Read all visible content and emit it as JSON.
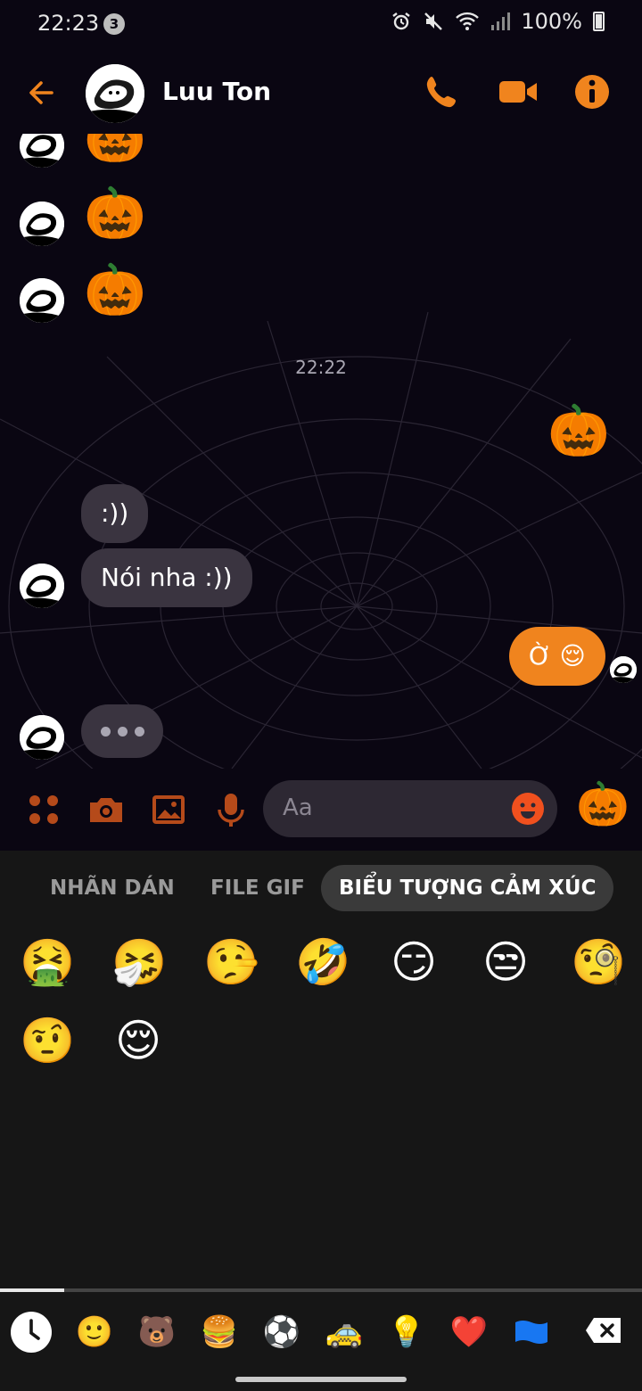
{
  "status_bar": {
    "time": "22:23",
    "notification_count": "3",
    "battery_percent": "100%"
  },
  "header": {
    "contact_name": "Luu Ton",
    "accent_color": "#f0841e"
  },
  "chat": {
    "received_emoji_1": "🎃",
    "received_emoji_2": "🎃",
    "received_emoji_3": "🎃",
    "timestamp": "22:22",
    "sent_emoji": "🎃",
    "received_messages": [
      ":))",
      "Nói nha :))"
    ],
    "sent_message": "Ờ 😌",
    "typing_indicator": "typing"
  },
  "composer": {
    "placeholder": "Aa",
    "quick_reaction": "🎃"
  },
  "emoji_panel": {
    "tabs": [
      "NHÃN DÁN",
      "FILE GIF",
      "BIỂU TƯỢNG CẢM XÚC"
    ],
    "active_tab": "BIỂU TƯỢNG CẢM XÚC",
    "recent_emojis": [
      "🤮",
      "🤧",
      "🤥",
      "🤣",
      "😏",
      "😒",
      "🧐",
      "🤨",
      "😌"
    ],
    "scroll_progress": 0.1,
    "categories": [
      "recent-icon",
      "🙂",
      "🐻",
      "🍔",
      "⚽",
      "🚕",
      "💡",
      "❤️",
      "🏳️",
      "delete-icon"
    ]
  }
}
